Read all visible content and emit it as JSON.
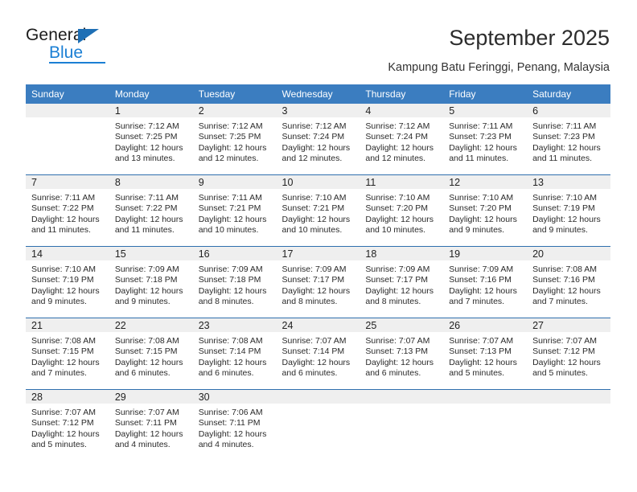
{
  "brand": {
    "name_part1": "General",
    "name_part2": "Blue"
  },
  "header": {
    "title": "September 2025",
    "subtitle": "Kampung Batu Feringgi, Penang, Malaysia"
  },
  "colors": {
    "header_blue": "#3b7dc0",
    "row_divider_blue": "#2f6fae",
    "date_band_gray": "#efefef",
    "logo_blue": "#1b7fd4"
  },
  "calendar": {
    "weekday_headers": [
      "Sunday",
      "Monday",
      "Tuesday",
      "Wednesday",
      "Thursday",
      "Friday",
      "Saturday"
    ],
    "weeks": [
      [
        {
          "day": "",
          "sunrise": "",
          "sunset": "",
          "daylight1": "",
          "daylight2": ""
        },
        {
          "day": "1",
          "sunrise": "Sunrise: 7:12 AM",
          "sunset": "Sunset: 7:25 PM",
          "daylight1": "Daylight: 12 hours",
          "daylight2": "and 13 minutes."
        },
        {
          "day": "2",
          "sunrise": "Sunrise: 7:12 AM",
          "sunset": "Sunset: 7:25 PM",
          "daylight1": "Daylight: 12 hours",
          "daylight2": "and 12 minutes."
        },
        {
          "day": "3",
          "sunrise": "Sunrise: 7:12 AM",
          "sunset": "Sunset: 7:24 PM",
          "daylight1": "Daylight: 12 hours",
          "daylight2": "and 12 minutes."
        },
        {
          "day": "4",
          "sunrise": "Sunrise: 7:12 AM",
          "sunset": "Sunset: 7:24 PM",
          "daylight1": "Daylight: 12 hours",
          "daylight2": "and 12 minutes."
        },
        {
          "day": "5",
          "sunrise": "Sunrise: 7:11 AM",
          "sunset": "Sunset: 7:23 PM",
          "daylight1": "Daylight: 12 hours",
          "daylight2": "and 11 minutes."
        },
        {
          "day": "6",
          "sunrise": "Sunrise: 7:11 AM",
          "sunset": "Sunset: 7:23 PM",
          "daylight1": "Daylight: 12 hours",
          "daylight2": "and 11 minutes."
        }
      ],
      [
        {
          "day": "7",
          "sunrise": "Sunrise: 7:11 AM",
          "sunset": "Sunset: 7:22 PM",
          "daylight1": "Daylight: 12 hours",
          "daylight2": "and 11 minutes."
        },
        {
          "day": "8",
          "sunrise": "Sunrise: 7:11 AM",
          "sunset": "Sunset: 7:22 PM",
          "daylight1": "Daylight: 12 hours",
          "daylight2": "and 11 minutes."
        },
        {
          "day": "9",
          "sunrise": "Sunrise: 7:11 AM",
          "sunset": "Sunset: 7:21 PM",
          "daylight1": "Daylight: 12 hours",
          "daylight2": "and 10 minutes."
        },
        {
          "day": "10",
          "sunrise": "Sunrise: 7:10 AM",
          "sunset": "Sunset: 7:21 PM",
          "daylight1": "Daylight: 12 hours",
          "daylight2": "and 10 minutes."
        },
        {
          "day": "11",
          "sunrise": "Sunrise: 7:10 AM",
          "sunset": "Sunset: 7:20 PM",
          "daylight1": "Daylight: 12 hours",
          "daylight2": "and 10 minutes."
        },
        {
          "day": "12",
          "sunrise": "Sunrise: 7:10 AM",
          "sunset": "Sunset: 7:20 PM",
          "daylight1": "Daylight: 12 hours",
          "daylight2": "and 9 minutes."
        },
        {
          "day": "13",
          "sunrise": "Sunrise: 7:10 AM",
          "sunset": "Sunset: 7:19 PM",
          "daylight1": "Daylight: 12 hours",
          "daylight2": "and 9 minutes."
        }
      ],
      [
        {
          "day": "14",
          "sunrise": "Sunrise: 7:10 AM",
          "sunset": "Sunset: 7:19 PM",
          "daylight1": "Daylight: 12 hours",
          "daylight2": "and 9 minutes."
        },
        {
          "day": "15",
          "sunrise": "Sunrise: 7:09 AM",
          "sunset": "Sunset: 7:18 PM",
          "daylight1": "Daylight: 12 hours",
          "daylight2": "and 9 minutes."
        },
        {
          "day": "16",
          "sunrise": "Sunrise: 7:09 AM",
          "sunset": "Sunset: 7:18 PM",
          "daylight1": "Daylight: 12 hours",
          "daylight2": "and 8 minutes."
        },
        {
          "day": "17",
          "sunrise": "Sunrise: 7:09 AM",
          "sunset": "Sunset: 7:17 PM",
          "daylight1": "Daylight: 12 hours",
          "daylight2": "and 8 minutes."
        },
        {
          "day": "18",
          "sunrise": "Sunrise: 7:09 AM",
          "sunset": "Sunset: 7:17 PM",
          "daylight1": "Daylight: 12 hours",
          "daylight2": "and 8 minutes."
        },
        {
          "day": "19",
          "sunrise": "Sunrise: 7:09 AM",
          "sunset": "Sunset: 7:16 PM",
          "daylight1": "Daylight: 12 hours",
          "daylight2": "and 7 minutes."
        },
        {
          "day": "20",
          "sunrise": "Sunrise: 7:08 AM",
          "sunset": "Sunset: 7:16 PM",
          "daylight1": "Daylight: 12 hours",
          "daylight2": "and 7 minutes."
        }
      ],
      [
        {
          "day": "21",
          "sunrise": "Sunrise: 7:08 AM",
          "sunset": "Sunset: 7:15 PM",
          "daylight1": "Daylight: 12 hours",
          "daylight2": "and 7 minutes."
        },
        {
          "day": "22",
          "sunrise": "Sunrise: 7:08 AM",
          "sunset": "Sunset: 7:15 PM",
          "daylight1": "Daylight: 12 hours",
          "daylight2": "and 6 minutes."
        },
        {
          "day": "23",
          "sunrise": "Sunrise: 7:08 AM",
          "sunset": "Sunset: 7:14 PM",
          "daylight1": "Daylight: 12 hours",
          "daylight2": "and 6 minutes."
        },
        {
          "day": "24",
          "sunrise": "Sunrise: 7:07 AM",
          "sunset": "Sunset: 7:14 PM",
          "daylight1": "Daylight: 12 hours",
          "daylight2": "and 6 minutes."
        },
        {
          "day": "25",
          "sunrise": "Sunrise: 7:07 AM",
          "sunset": "Sunset: 7:13 PM",
          "daylight1": "Daylight: 12 hours",
          "daylight2": "and 6 minutes."
        },
        {
          "day": "26",
          "sunrise": "Sunrise: 7:07 AM",
          "sunset": "Sunset: 7:13 PM",
          "daylight1": "Daylight: 12 hours",
          "daylight2": "and 5 minutes."
        },
        {
          "day": "27",
          "sunrise": "Sunrise: 7:07 AM",
          "sunset": "Sunset: 7:12 PM",
          "daylight1": "Daylight: 12 hours",
          "daylight2": "and 5 minutes."
        }
      ],
      [
        {
          "day": "28",
          "sunrise": "Sunrise: 7:07 AM",
          "sunset": "Sunset: 7:12 PM",
          "daylight1": "Daylight: 12 hours",
          "daylight2": "and 5 minutes."
        },
        {
          "day": "29",
          "sunrise": "Sunrise: 7:07 AM",
          "sunset": "Sunset: 7:11 PM",
          "daylight1": "Daylight: 12 hours",
          "daylight2": "and 4 minutes."
        },
        {
          "day": "30",
          "sunrise": "Sunrise: 7:06 AM",
          "sunset": "Sunset: 7:11 PM",
          "daylight1": "Daylight: 12 hours",
          "daylight2": "and 4 minutes."
        },
        {
          "day": "",
          "sunrise": "",
          "sunset": "",
          "daylight1": "",
          "daylight2": ""
        },
        {
          "day": "",
          "sunrise": "",
          "sunset": "",
          "daylight1": "",
          "daylight2": ""
        },
        {
          "day": "",
          "sunrise": "",
          "sunset": "",
          "daylight1": "",
          "daylight2": ""
        },
        {
          "day": "",
          "sunrise": "",
          "sunset": "",
          "daylight1": "",
          "daylight2": ""
        }
      ]
    ]
  }
}
